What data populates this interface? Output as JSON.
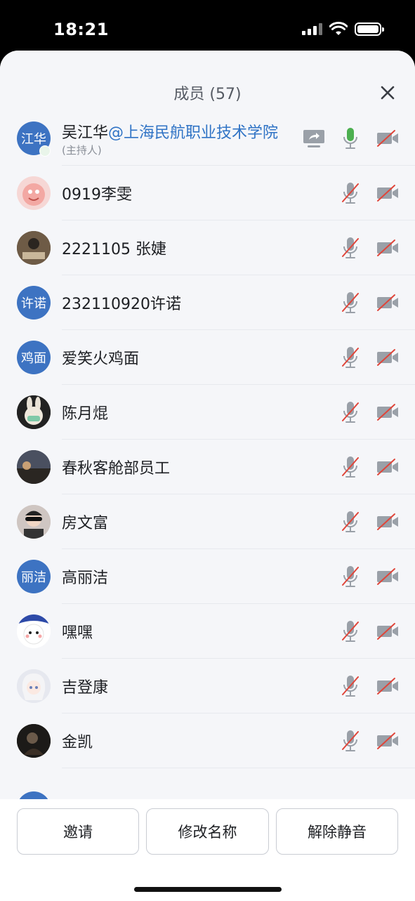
{
  "status_bar": {
    "time": "18:21"
  },
  "sheet": {
    "title": "成员 (57)"
  },
  "members": [
    {
      "avatar_text": "江华",
      "name": "吴江华",
      "org": "@上海民航职业技术学院",
      "role": "(主持人)",
      "mic_on": true,
      "camera_on": false,
      "sharing": true
    },
    {
      "avatar_text": "",
      "name": "0919李雯",
      "mic_on": false,
      "camera_on": false
    },
    {
      "avatar_text": "",
      "name": "2221105 张婕",
      "mic_on": false,
      "camera_on": false
    },
    {
      "avatar_text": "许诺",
      "name": "232110920许诺",
      "mic_on": false,
      "camera_on": false
    },
    {
      "avatar_text": "鸡面",
      "name": "爱笑火鸡面",
      "mic_on": false,
      "camera_on": false
    },
    {
      "avatar_text": "",
      "name": "陈月焜",
      "mic_on": false,
      "camera_on": false
    },
    {
      "avatar_text": "",
      "name": "春秋客舱部员工",
      "mic_on": false,
      "camera_on": false
    },
    {
      "avatar_text": "",
      "name": "房文富",
      "mic_on": false,
      "camera_on": false
    },
    {
      "avatar_text": "丽洁",
      "name": "高丽洁",
      "mic_on": false,
      "camera_on": false
    },
    {
      "avatar_text": "",
      "name": "嘿嘿",
      "mic_on": false,
      "camera_on": false
    },
    {
      "avatar_text": "",
      "name": "吉登康",
      "mic_on": false,
      "camera_on": false
    },
    {
      "avatar_text": "",
      "name": "金凯",
      "mic_on": false,
      "camera_on": false
    }
  ],
  "actions": {
    "invite": "邀请",
    "rename": "修改名称",
    "unmute": "解除静音"
  },
  "colors": {
    "accent": "#2f73c5",
    "avatar_blue": "#3d73c2",
    "mic_active": "#4caf50",
    "muted_red": "#e0453a",
    "icon_gray": "#9aa0a8"
  }
}
